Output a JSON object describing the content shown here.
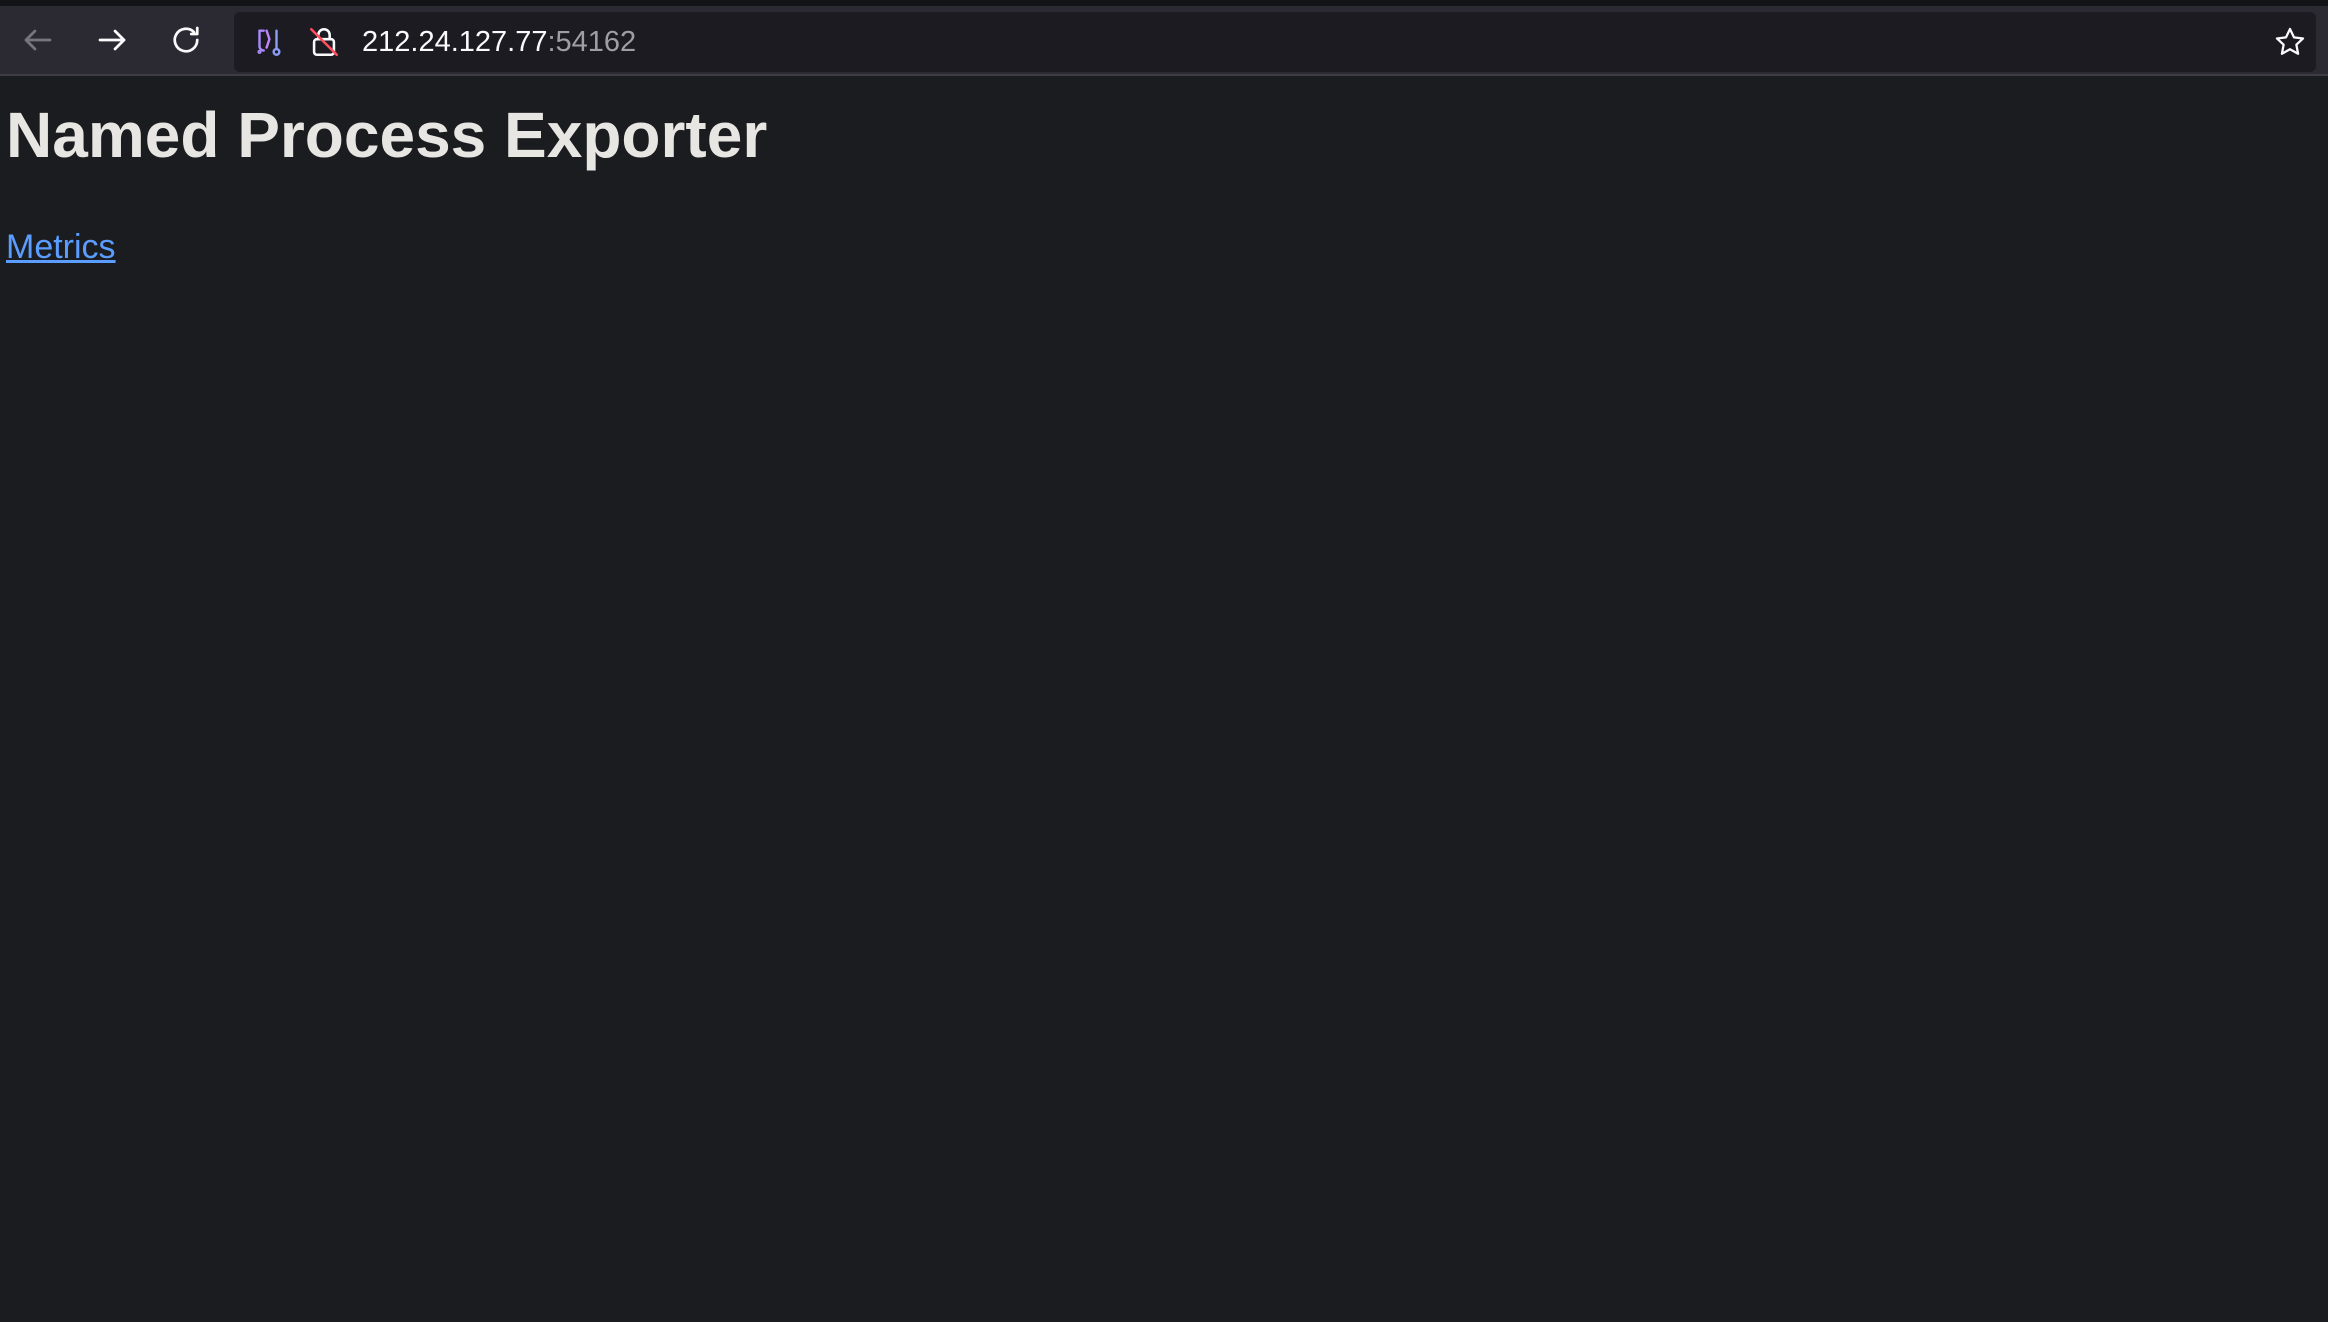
{
  "browser": {
    "url_host": "212.24.127.77",
    "url_port": ":54162",
    "icons": {
      "back": "arrow-left-icon",
      "forward": "arrow-right-icon",
      "reload": "reload-icon",
      "tracking": "tracking-protection-icon",
      "insecure": "insecure-connection-icon",
      "bookmark": "star-icon"
    }
  },
  "page": {
    "heading": "Named Process Exporter",
    "link_label": "Metrics"
  },
  "colors": {
    "page_bg": "#1b1c1f",
    "toolbar_bg": "#2b2a33",
    "link": "#5b9dff",
    "heading": "#e8e6e3"
  }
}
